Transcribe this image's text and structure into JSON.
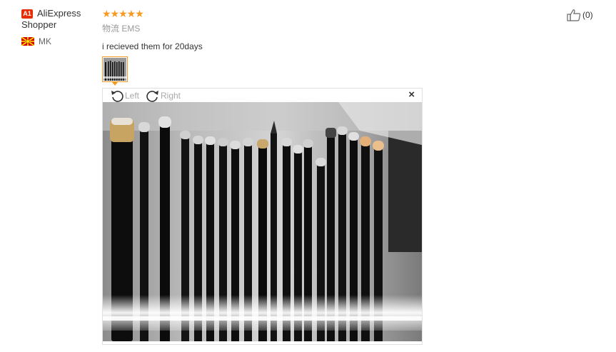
{
  "reviewer": {
    "badge": "A1",
    "name_line1": "AliExpress",
    "name_line2": "Shopper",
    "country": "MK"
  },
  "review": {
    "stars": "★★★★★",
    "rating": 5,
    "logistics": "物流 EMS",
    "text": "i recieved them for 20days"
  },
  "viewer": {
    "rotate_left_label": "Left",
    "rotate_right_label": "Right",
    "close_label": "×"
  },
  "helpful": {
    "count_label": "(0)"
  },
  "colors": {
    "accent": "#f79a22",
    "badge": "#e62e04"
  }
}
